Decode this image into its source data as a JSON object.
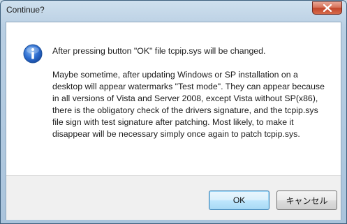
{
  "window": {
    "title": "Continue?"
  },
  "dialog": {
    "icon": "info-icon",
    "main_message": "After pressing button \"OK\" file tcpip.sys will be changed.",
    "detail_message": "Maybe sometime, after updating Windows or SP installation on a desktop will appear watermarks \"Test mode\". They can appear because in all versions of Vista and Server 2008, except Vista without SP(x86), there is the obligatory check of the drivers signature, and the tcpip.sys file sign with test signature after patching. Most likely, to make it disappear will be necessary simply once again to patch tcpip.sys."
  },
  "buttons": {
    "ok_label": "OK",
    "cancel_label": "キャンセル"
  },
  "colors": {
    "accent": "#3c7fb1",
    "close_button": "#c2462c"
  }
}
